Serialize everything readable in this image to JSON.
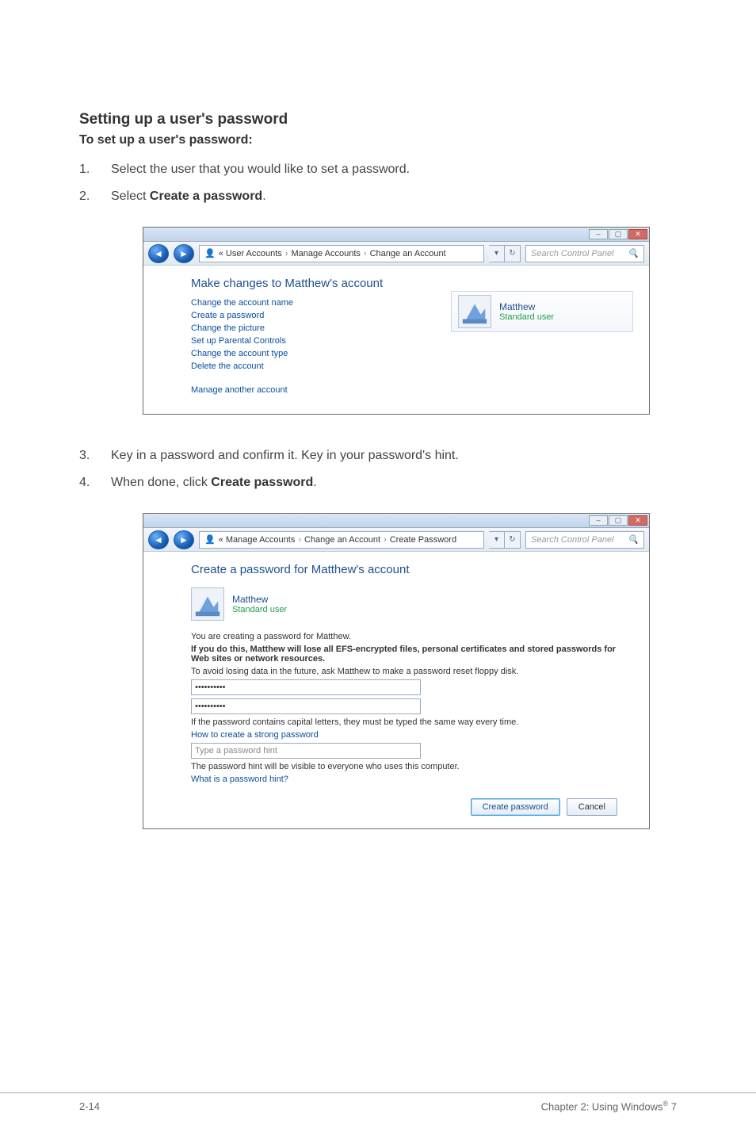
{
  "doc": {
    "section_title": "Setting up a user's password",
    "subhead": "To set up a user's password:",
    "steps_a": [
      {
        "num": "1.",
        "text": "Select the user that you would like to set a password."
      },
      {
        "num": "2.",
        "pre": "Select ",
        "bold": "Create a password",
        "post": "."
      }
    ],
    "steps_b": [
      {
        "num": "3.",
        "text": "Key in a password and confirm it. Key in your password's hint."
      },
      {
        "num": "4.",
        "pre": "When done, click ",
        "bold": "Create password",
        "post": "."
      }
    ]
  },
  "shot1": {
    "breadcrumb": [
      "« User Accounts",
      "Manage Accounts",
      "Change an Account"
    ],
    "search_placeholder": "Search Control Panel",
    "title": "Make changes to Matthew's account",
    "links": [
      "Change the account name",
      "Create a password",
      "Change the picture",
      "Set up Parental Controls",
      "Change the account type",
      "Delete the account"
    ],
    "links2": [
      "Manage another account"
    ],
    "user": {
      "name": "Matthew",
      "role": "Standard user"
    }
  },
  "shot2": {
    "breadcrumb": [
      "« Manage Accounts",
      "Change an Account",
      "Create Password"
    ],
    "search_placeholder": "Search Control Panel",
    "title": "Create a password for Matthew's account",
    "user": {
      "name": "Matthew",
      "role": "Standard user"
    },
    "line_creating": "You are creating a password for Matthew.",
    "warn": "If you do this, Matthew will lose all EFS-encrypted files, personal certificates and stored passwords for Web sites or network resources.",
    "avoid": "To avoid losing data in the future, ask Matthew to make a password reset floppy disk.",
    "pw1": "••••••••••",
    "pw2": "••••••••••",
    "caps_note": "If the password contains capital letters, they must be typed the same way every time.",
    "howto_link": "How to create a strong password",
    "hint_placeholder": "Type a password hint",
    "hint_note": "The password hint will be visible to everyone who uses this computer.",
    "whatis_link": "What is a password hint?",
    "btn_create": "Create password",
    "btn_cancel": "Cancel"
  },
  "footer": {
    "left": "2-14",
    "right_pre": "Chapter 2: Using Windows",
    "right_sup": "®",
    "right_post": " 7"
  }
}
